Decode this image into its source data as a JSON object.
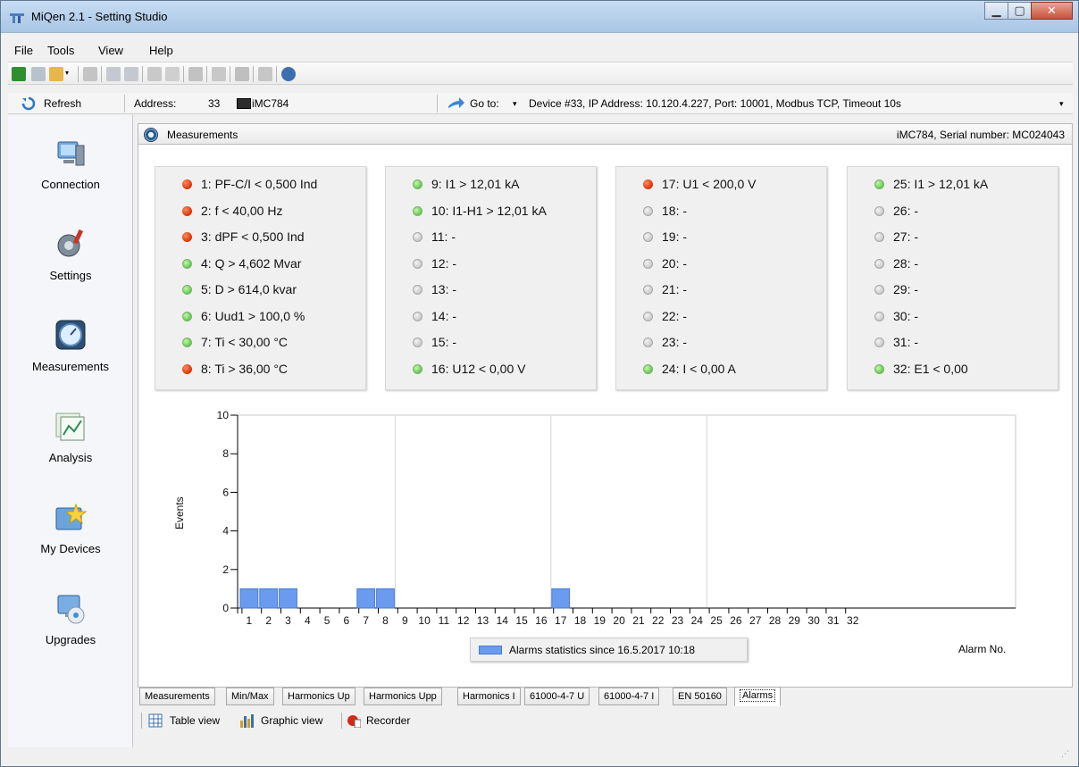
{
  "window": {
    "title": "MiQen 2.1 - Setting Studio"
  },
  "menu": [
    "File",
    "Tools",
    "View",
    "Help"
  ],
  "toolbar2": {
    "refresh": "Refresh",
    "address_label": "Address:",
    "address_value": "33",
    "device_model": "iMC784",
    "goto_label": "Go to:",
    "goto_target": "Device #33, IP Address: 10.120.4.227, Port: 10001, Modbus TCP, Timeout 10s"
  },
  "sidebar": {
    "items": [
      {
        "label": "Connection",
        "icon": "connection-icon"
      },
      {
        "label": "Settings",
        "icon": "settings-icon"
      },
      {
        "label": "Measurements",
        "icon": "measurements-icon"
      },
      {
        "label": "Analysis",
        "icon": "analysis-icon"
      },
      {
        "label": "My Devices",
        "icon": "my-devices-icon"
      },
      {
        "label": "Upgrades",
        "icon": "upgrades-icon"
      }
    ]
  },
  "panel": {
    "title": "Measurements",
    "device_info": "iMC784, Serial number: MC024043"
  },
  "alarms": [
    [
      {
        "text": "1: PF-C/I < 0,500 Ind",
        "status": "red"
      },
      {
        "text": "2: f < 40,00 Hz",
        "status": "red"
      },
      {
        "text": "3: dPF < 0,500 Ind",
        "status": "red"
      },
      {
        "text": "4: Q > 4,602 Mvar",
        "status": "green"
      },
      {
        "text": "5: D > 614,0 kvar",
        "status": "green"
      },
      {
        "text": "6: Uud1 > 100,0 %",
        "status": "green"
      },
      {
        "text": "7: Ti < 30,00 °C",
        "status": "green"
      },
      {
        "text": "8: Ti > 36,00 °C",
        "status": "red"
      }
    ],
    [
      {
        "text": "9: I1 > 12,01 kA",
        "status": "green"
      },
      {
        "text": "10: I1-H1 > 12,01 kA",
        "status": "green"
      },
      {
        "text": "11: -",
        "status": "grey"
      },
      {
        "text": "12: -",
        "status": "grey"
      },
      {
        "text": "13: -",
        "status": "grey"
      },
      {
        "text": "14: -",
        "status": "grey"
      },
      {
        "text": "15: -",
        "status": "grey"
      },
      {
        "text": "16: U12 < 0,00 V",
        "status": "green"
      }
    ],
    [
      {
        "text": "17: U1 < 200,0 V",
        "status": "red"
      },
      {
        "text": "18: -",
        "status": "grey"
      },
      {
        "text": "19: -",
        "status": "grey"
      },
      {
        "text": "20: -",
        "status": "grey"
      },
      {
        "text": "21: -",
        "status": "grey"
      },
      {
        "text": "22: -",
        "status": "grey"
      },
      {
        "text": "23: -",
        "status": "grey"
      },
      {
        "text": "24: I < 0,00 A",
        "status": "green"
      }
    ],
    [
      {
        "text": "25: I1 > 12,01 kA",
        "status": "green"
      },
      {
        "text": "26: -",
        "status": "grey"
      },
      {
        "text": "27: -",
        "status": "grey"
      },
      {
        "text": "28: -",
        "status": "grey"
      },
      {
        "text": "29: -",
        "status": "grey"
      },
      {
        "text": "30: -",
        "status": "grey"
      },
      {
        "text": "31: -",
        "status": "grey"
      },
      {
        "text": "32: E1 < 0,00",
        "status": "green"
      }
    ]
  ],
  "status_colors": {
    "red": "#dd3d12",
    "green": "#6ed15a",
    "grey": "#d0d0d0"
  },
  "chart_data": {
    "type": "bar",
    "categories": [
      "1",
      "2",
      "3",
      "4",
      "5",
      "6",
      "7",
      "8",
      "9",
      "10",
      "11",
      "12",
      "13",
      "14",
      "15",
      "16",
      "17",
      "18",
      "19",
      "20",
      "21",
      "22",
      "23",
      "24",
      "25",
      "26",
      "27",
      "28",
      "29",
      "30",
      "31",
      "32"
    ],
    "values": [
      1,
      1,
      1,
      0,
      0,
      0,
      1,
      1,
      0,
      0,
      0,
      0,
      0,
      0,
      0,
      0,
      1,
      0,
      0,
      0,
      0,
      0,
      0,
      0,
      0,
      0,
      0,
      0,
      0,
      0,
      0,
      0
    ],
    "ylabel": "Events",
    "xlabel": "Alarm No.",
    "ylim": [
      0,
      10
    ],
    "yticks": [
      0,
      2,
      4,
      6,
      8,
      10
    ],
    "legend": "Alarms statistics since 16.5.2017 10:18",
    "bar_color": "#6b9bef",
    "grid": true
  },
  "tabs": [
    "Measurements",
    "Min/Max",
    "Harmonics Up",
    "Harmonics Upp",
    "Harmonics I",
    "61000-4-7 U",
    "61000-4-7 I",
    "EN 50160",
    "Alarms"
  ],
  "active_tab": "Alarms",
  "viewbar": {
    "table_view": "Table view",
    "graphic_view": "Graphic view",
    "recorder": "Recorder"
  }
}
